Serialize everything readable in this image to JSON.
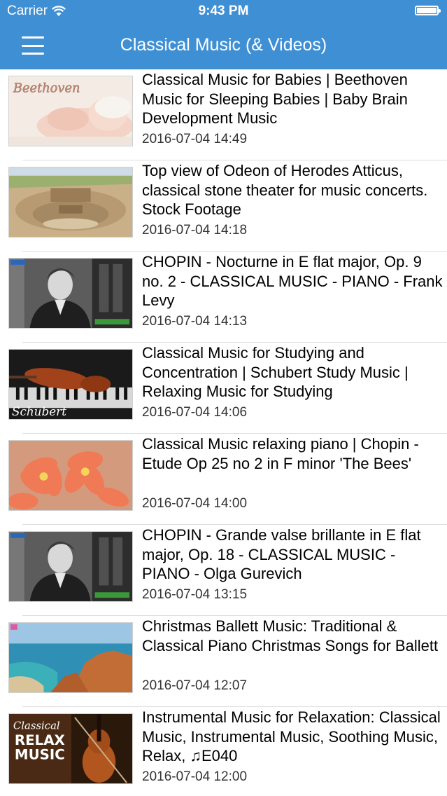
{
  "status_bar": {
    "carrier": "Carrier",
    "time": "9:43 PM",
    "battery_level": 1.0
  },
  "nav": {
    "title": "Classical Music (& Videos)"
  },
  "colors": {
    "header_bg": "#3f8fd4",
    "separator": "#dedede"
  },
  "videos": [
    {
      "title": "Classical Music for Babies | Beethoven Music for Sleeping Babies | Baby Brain Development Music",
      "date": "2016-07-04 14:49",
      "thumb_text": "Beethoven"
    },
    {
      "title": "Top view of Odeon of Herodes Atticus, classical stone theater for music concerts. Stock Footage",
      "date": "2016-07-04 14:18"
    },
    {
      "title": "CHOPIN -  Nocturne in E flat major, Op. 9 no. 2 - CLASSICAL MUSIC - PIANO - Frank Levy",
      "date": "2016-07-04 14:13"
    },
    {
      "title": "Classical Music for Studying and Concentration | Schubert Study Music | Relaxing Music for Studying",
      "date": "2016-07-04 14:06",
      "thumb_text": "Schubert"
    },
    {
      "title": "Classical Music relaxing piano | Chopin - Etude Op 25 no 2 in F minor 'The Bees'",
      "date": "2016-07-04 14:00"
    },
    {
      "title": "CHOPIN - Grande valse brillante in E flat major, Op. 18 - CLASSICAL MUSIC - PIANO - Olga Gurevich",
      "date": "2016-07-04 13:15"
    },
    {
      "title": "Christmas Ballett Music: Traditional & Classical Piano Christmas Songs for Ballett",
      "date": "2016-07-04 12:07"
    },
    {
      "title": "Instrumental Music for Relaxation: Classical Music, Instrumental Music, Soothing Music, Relax, ♫E040",
      "date": "2016-07-04 12:00",
      "thumb_text": [
        "Classical",
        "RELAX",
        "MUSIC"
      ]
    }
  ]
}
